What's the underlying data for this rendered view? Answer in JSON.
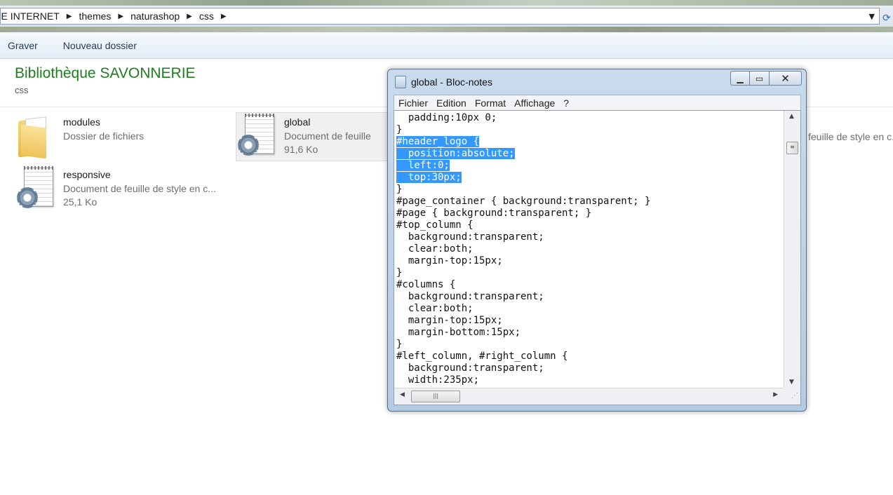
{
  "address": {
    "crumbs": [
      "TE INTERNET",
      "themes",
      "naturashop",
      "css"
    ],
    "dropdown_icon": "chevron-down-icon",
    "refresh_icon": "refresh-icon"
  },
  "toolbar": {
    "burn_label": "Graver",
    "new_folder_label": "Nouveau dossier"
  },
  "library": {
    "title": "Bibliothèque SAVONNERIE",
    "subtitle": "css"
  },
  "files": [
    {
      "name": "modules",
      "description": "Dossier de fichiers",
      "size": "",
      "icon": "folder-icon"
    },
    {
      "name": "global",
      "description": "Document de feuille",
      "size": "91,6 Ko",
      "icon": "css-file-icon"
    },
    {
      "name": "responsive",
      "description": "Document de feuille de style en c...",
      "size": "25,1 Ko",
      "icon": "css-file-icon"
    }
  ],
  "clipped_description": "feuille de style en c...",
  "notepad": {
    "title": "global - Bloc-notes",
    "menu": [
      "Fichier",
      "Edition",
      "Format",
      "Affichage",
      "?"
    ],
    "lines": [
      "  padding:10px 0;",
      "}",
      "#header_logo {",
      "  position:absolute;",
      "  left:0;",
      "  top:30px;",
      "}",
      "#page_container { background:transparent; }",
      "#page { background:transparent; }",
      "#top_column {",
      "  background:transparent;",
      "  clear:both;",
      "  margin-top:15px;",
      "}",
      "#columns {",
      "  background:transparent;",
      "  clear:both;",
      "  margin-top:15px;",
      "  margin-bottom:15px;",
      "}",
      "#left_column, #right_column {",
      "  background:transparent;",
      "  width:235px;"
    ],
    "selected_lines": [
      2,
      3,
      4,
      5
    ],
    "selection_color": "#3399ff"
  },
  "colors": {
    "library_title": "#1e7f1e",
    "toolbar_text": "#1e395b"
  }
}
